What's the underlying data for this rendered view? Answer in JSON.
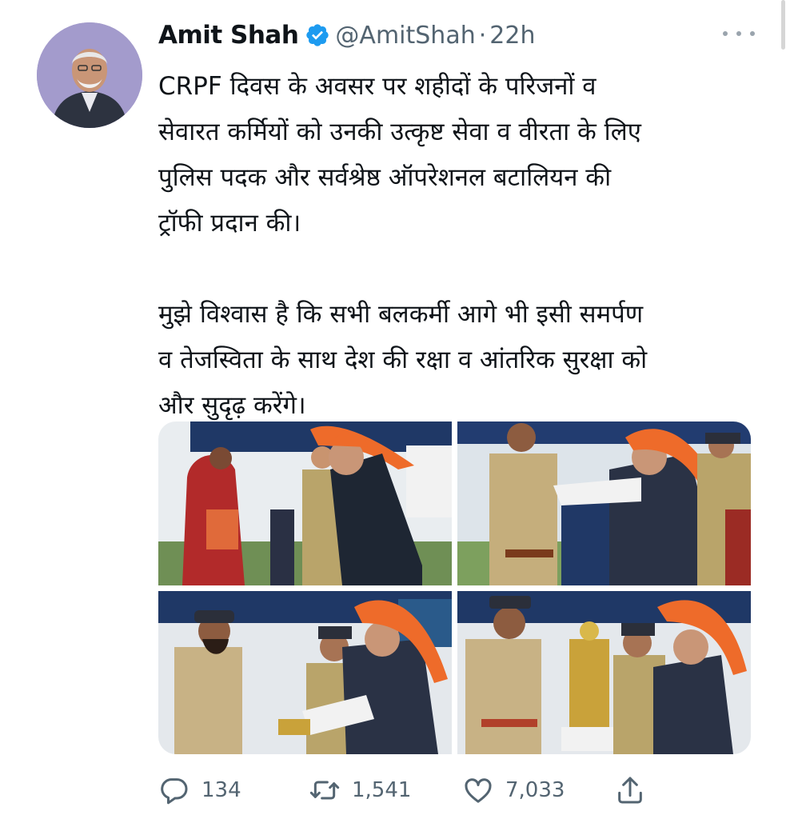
{
  "tweet": {
    "author_name": "Amit Shah",
    "handle": "@AmitShah",
    "separator": "·",
    "time": "22h",
    "text": "CRPF दिवस के अवसर पर शहीदों के परिजनों व\nसेवारत कर्मियों को उनकी उत्कृष्ट सेवा व वीरता के लिए\nपुलिस पदक और सर्वश्रेष्ठ ऑपरेशनल बटालियन की\nट्रॉफी प्रदान की।\n\nमुझे विश्वास है कि सभी बलकर्मी आगे भी इसी समर्पण\nव तेजस्विता के साथ देश की रक्षा व आंतरिक सुरक्षा को\nऔर सुदृढ़ करेंगे।"
  },
  "media": {
    "photos": [
      {
        "description_icon": "photo"
      },
      {
        "description_icon": "photo"
      },
      {
        "description_icon": "photo"
      },
      {
        "description_icon": "photo"
      }
    ]
  },
  "actions": {
    "replies": "134",
    "retweets": "1,541",
    "likes": "7,033"
  },
  "colors": {
    "verified": "#1d9bf0",
    "muted": "#536471",
    "saffron": "#ef6a2a"
  }
}
